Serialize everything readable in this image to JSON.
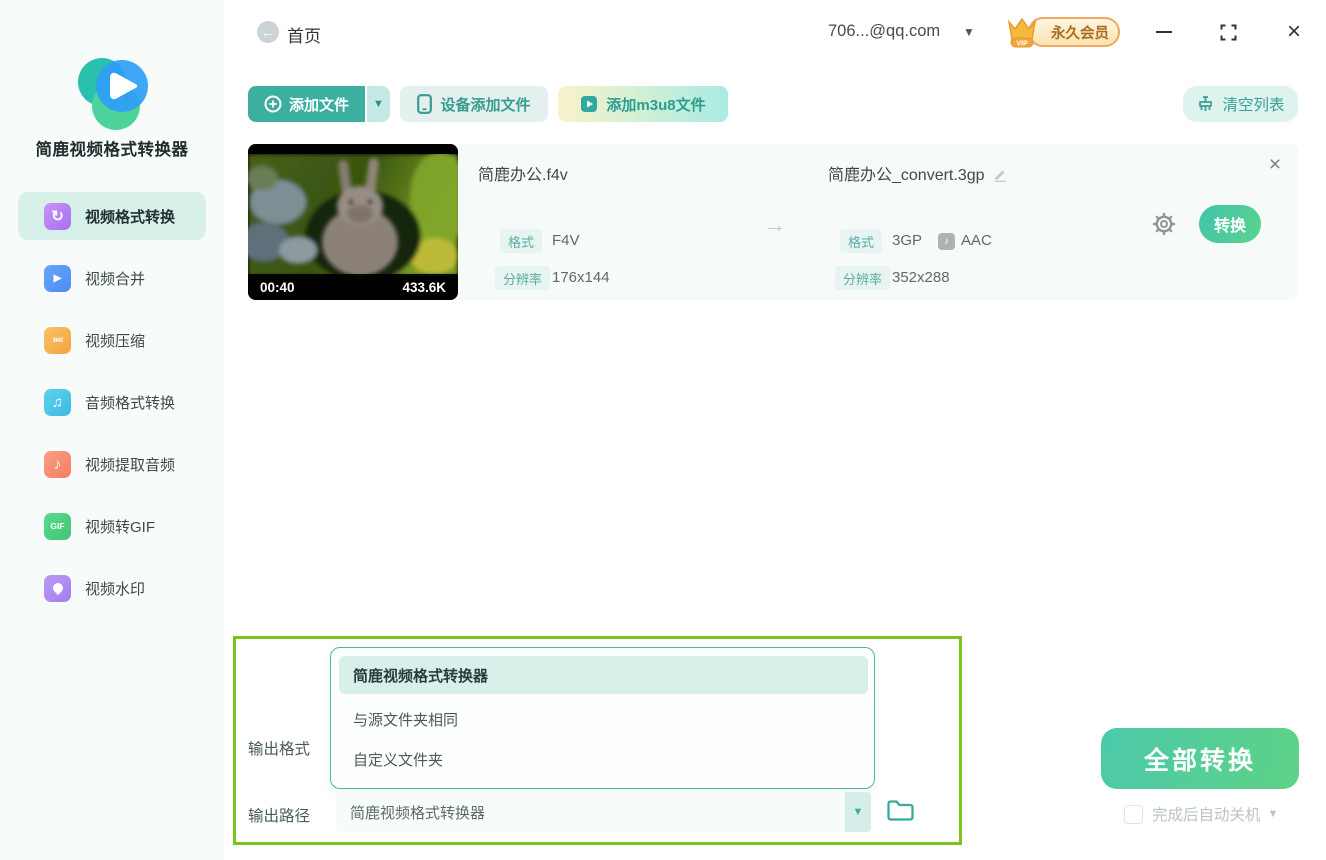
{
  "app": {
    "name": "简鹿视频格式转换器"
  },
  "topbar": {
    "home": "首页",
    "account": "706...@qq.com",
    "vip_label": "永久会员",
    "vip_tag": "VIP"
  },
  "sidebar": {
    "items": [
      {
        "label": "视频格式转换",
        "icon": "video-format-convert-icon",
        "active": true
      },
      {
        "label": "视频合并",
        "icon": "video-merge-icon"
      },
      {
        "label": "视频压缩",
        "icon": "video-compress-icon"
      },
      {
        "label": "音频格式转换",
        "icon": "audio-format-convert-icon"
      },
      {
        "label": "视频提取音频",
        "icon": "audio-extract-icon"
      },
      {
        "label": "视频转GIF",
        "icon": "gif-icon",
        "badge_text": "GIF"
      },
      {
        "label": "视频水印",
        "icon": "watermark-icon"
      }
    ]
  },
  "toolbar": {
    "add_file": "添加文件",
    "device_add": "设备添加文件",
    "add_m3u8": "添加m3u8文件",
    "clear_list": "清空列表"
  },
  "file_item": {
    "thumbnail": {
      "duration": "00:40",
      "size": "433.6K"
    },
    "source": {
      "name": "简鹿办公.f4v",
      "format_label": "格式",
      "format": "F4V",
      "resolution_label": "分辨率",
      "resolution": "176x144"
    },
    "target": {
      "name": "简鹿办公_convert.3gp",
      "format_label": "格式",
      "format": "3GP",
      "audio_codec": "AAC",
      "resolution_label": "分辨率",
      "resolution": "352x288"
    },
    "convert_button": "转换"
  },
  "output_panel": {
    "format_label": "输出格式",
    "path_label": "输出路径",
    "dropdown_options": [
      "简鹿视频格式转换器",
      "与源文件夹相同",
      "自定义文件夹"
    ],
    "selected_path": "简鹿视频格式转换器"
  },
  "footer": {
    "convert_all": "全部转换",
    "auto_shutdown": "完成后自动关机"
  },
  "colors": {
    "accent_teal": "#3cafa1",
    "active_nav_bg": "#d8f0ea",
    "highlight_box_green": "#7ac41d",
    "convert_gradient_start": "#42c3ac",
    "convert_gradient_end": "#5ad48d",
    "vip_text": "#aa6b1d"
  }
}
